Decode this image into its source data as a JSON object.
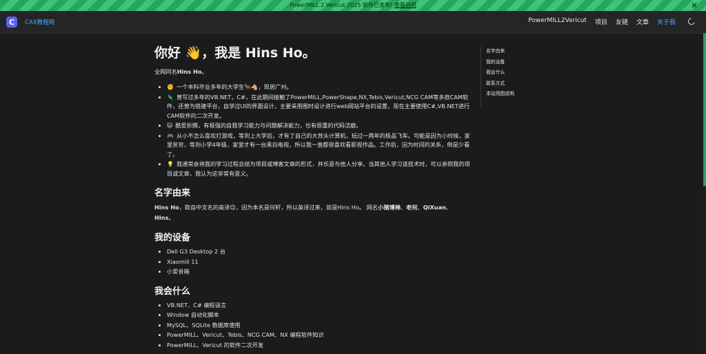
{
  "banner": {
    "text": "PowerMILL 2 Vericut 2025 软件已发布! ",
    "link": "查看说明",
    "close_glyph": "✕"
  },
  "nav": {
    "brand": "CAX教程网",
    "logo_letter": "C",
    "links": [
      "PowerMILL2Vericut",
      "项目",
      "友链",
      "文章",
      "关于我"
    ],
    "active_index": 4
  },
  "page": {
    "title": "你好 👋，我是 Hins Ho。",
    "intro_prefix": "全网同名",
    "intro_bold": "Hins Ho",
    "intro_suffix": "。",
    "bullets": [
      {
        "icon": "✊",
        "text": "一个本科毕业多年的大学生🐂🐴，现居广州。"
      },
      {
        "icon": "🦎",
        "text": "曾写过多年的VB.NET，C#，在此期间接触了PowerMILL,PowerShape,NX,Tebis,Vericut,NCG CAM等多款CAM软件，还曾为搭建平台，自学过UI的界面设计，主要采用图时设计进行web网站平台的设置，现在主要使用C#,VB.NET进行CAM软件的二次开发。"
      },
      {
        "icon": "🐱",
        "text": "酷爱折腾，有极强的自我学习能力与问题解决能力，也有很重的代码洁癖。"
      },
      {
        "icon": "🎮",
        "text": "从小不怎么喜欢打游戏，等到上大学后，才有了自己的大背头计算机，玩过一两年的极品飞车。可能是因为小时候，家里贫穷，等到小学4年级，家里才有一台黑白电视，所以我一直都很喜欢看影视作品。工作后，因为时间的关系，倒是少看了。"
      },
      {
        "icon": "💡",
        "text": "我通常会将我的学习过程总结为项目或博客文章的形式，并乐意与他人分享。当其他人学习该技术时，可以参照我的项目或文章，我认为这非常有意义。"
      }
    ],
    "section_name": {
      "heading": "名字由来",
      "p_bold1": "Hins Ho",
      "p_text1": "，取自中文名的英译😊，因为本名是何轩，所以英译过来，就是Hins Ho。 网名",
      "p_bold2": "小猪博禅",
      "p_sep1": "、",
      "p_bold3": "老何",
      "p_sep2": "、",
      "p_bold4": "QiXuan",
      "p_sep3": "、",
      "p_bold5": "Hins",
      "p_end": "。"
    },
    "section_devices": {
      "heading": "我的设备",
      "items": [
        "Dell G3 Desktop 2 台",
        "Xiaomill 11",
        "小爱音箱"
      ]
    },
    "section_skills": {
      "heading": "我会什么",
      "items": [
        "VB.NET、C# 编程语言",
        "Window 自动化脚本",
        "MySQL、SQLite 数据库使用",
        "PowerMILL、Vericut、Tebis、NCG CAM、NX 编程软件知识",
        "PowerMILL、Vericut 的软件二次开发"
      ]
    }
  },
  "toc": [
    "名字由来",
    "我的设备",
    "我会什么",
    "联系方式",
    "本站用图说明"
  ],
  "colors": {
    "accent": "#4fa3ff",
    "banner": "#26a65b",
    "logo": "#5b63f0",
    "background": "#1b1b1d"
  }
}
